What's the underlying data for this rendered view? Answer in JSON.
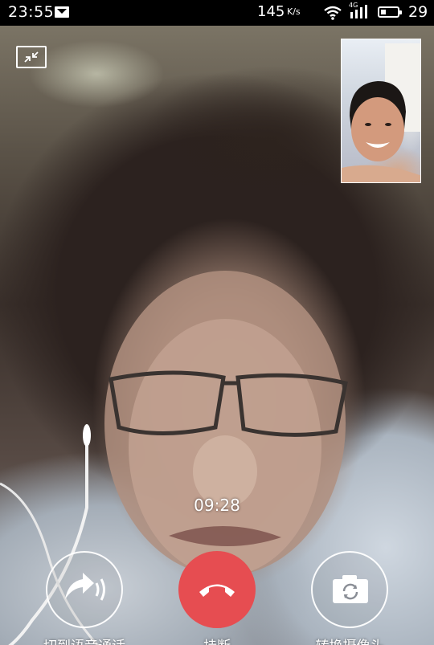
{
  "status_bar": {
    "time": "23:55",
    "network_speed": "145",
    "network_speed_unit": "K/s",
    "network_type": "4G",
    "battery_level": "29",
    "battery_fraction": 0.29,
    "icons": [
      "message-icon",
      "wifi-icon",
      "signal-icon",
      "battery-icon"
    ]
  },
  "call": {
    "duration": "09:28"
  },
  "controls": {
    "switch_voice_label": "切到语音通话",
    "hangup_label": "挂断",
    "switch_camera_label": "转换摄像头"
  },
  "colors": {
    "hangup": "#e64d51",
    "overlay_text": "#ffffff"
  }
}
